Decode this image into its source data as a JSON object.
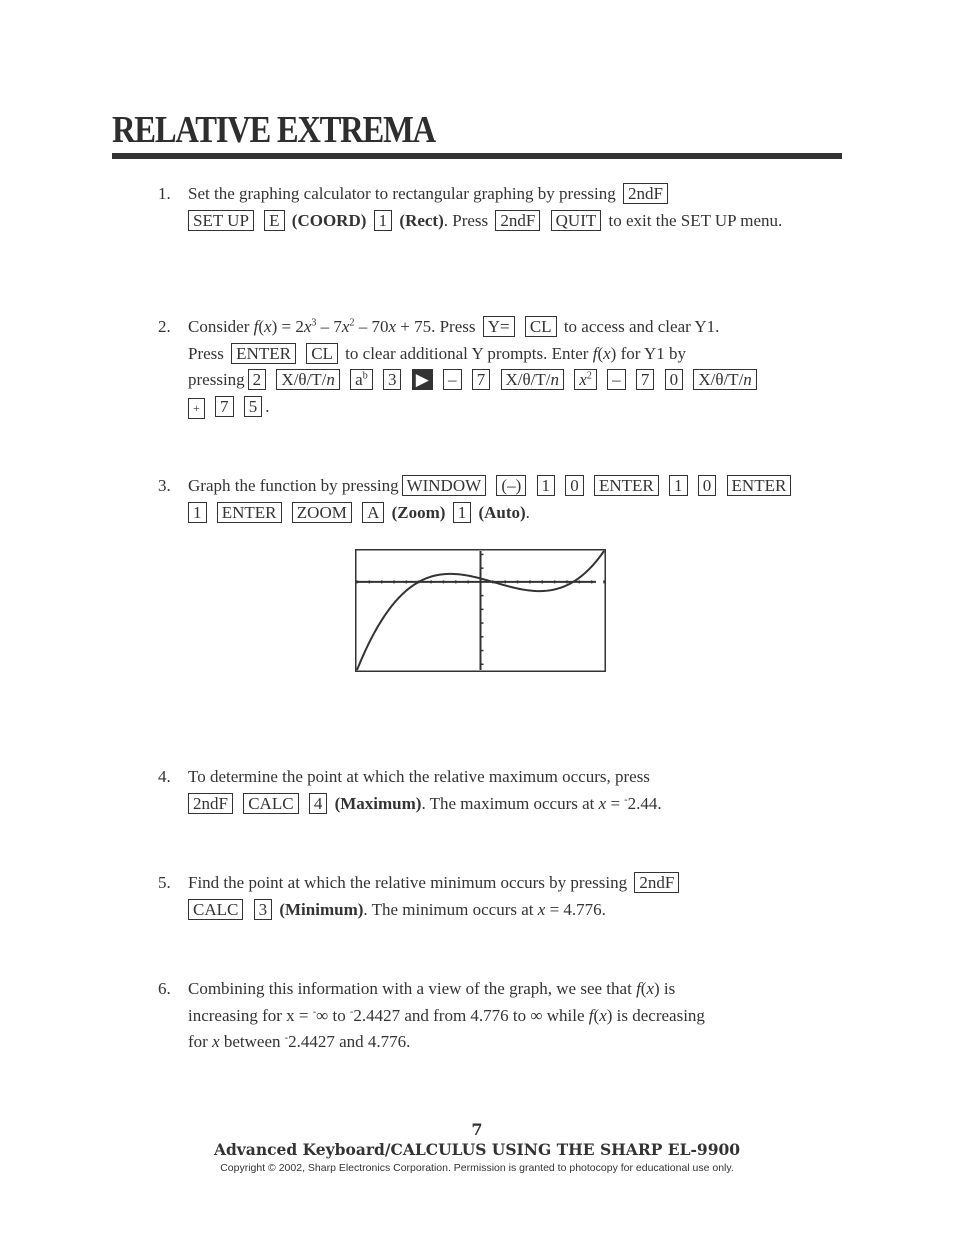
{
  "title": "RELATIVE EXTREMA",
  "steps": {
    "s1": {
      "num": "1.",
      "t1": "Set the graphing calculator to rectangular graphing by pressing",
      "k_2ndf": "2ndF",
      "k_setup": "SET UP",
      "k_e": "E",
      "coord": "(COORD)",
      "k_1": "1",
      "rect": "(Rect)",
      "t2": ".  Press",
      "k_2ndf2": "2ndF",
      "k_quit": "QUIT",
      "t3": "to exit the SET UP menu."
    },
    "s2": {
      "num": "2.",
      "t1": "Consider",
      "fx": "f",
      "x": "x",
      "eq_a": "(",
      "eq_b": ") = 2",
      "eq_c": "x",
      "exp3": "3",
      "eq_d": " – 7",
      "eq_e": "x",
      "exp2": "2",
      "eq_f": " – 70",
      "eq_g": "x",
      "eq_h": " + 75.  Press",
      "k_y": "Y=",
      "k_cl": "CL",
      "t2": "to access and clear Y1.",
      "t3": "Press",
      "k_enter": "ENTER",
      "k_cl2": "CL",
      "t4": "to clear additional Y prompts.  Enter",
      "t5": "for Y1 by",
      "t6": "pressing",
      "keys": [
        "2",
        "X/θ/T/",
        "a",
        "3",
        "▶",
        "–",
        "7",
        "X/θ/T/",
        "x",
        "–",
        "7",
        "0",
        "X/θ/T/",
        "+",
        "7",
        "5"
      ],
      "n": "n",
      "ab_sup": "b",
      "x2_sup": "2",
      "end": "."
    },
    "s3": {
      "num": "3.",
      "t1": "Graph the function by pressing",
      "keys": [
        "WINDOW",
        "(–)",
        "1",
        "0",
        "ENTER",
        "1",
        "0",
        "ENTER",
        "1",
        "ENTER",
        "ZOOM",
        "A"
      ],
      "zoom": "(Zoom)",
      "k_1": "1",
      "auto": "(Auto)",
      "end": "."
    },
    "s4": {
      "num": "4.",
      "t1": "To determine the point at which the relative maximum occurs, press",
      "k_2ndf": "2ndF",
      "k_calc": "CALC",
      "k_4": "4",
      "maximum": "(Maximum)",
      "t2": ".  The maximum occurs at",
      "x": "x",
      "t3": " = ",
      "value": "-2.44",
      "value_display": "2.44",
      "end": "."
    },
    "s5": {
      "num": "5.",
      "t1": "Find the point at which the relative minimum occurs by pressing",
      "k_2ndf": "2ndF",
      "k_calc": "CALC",
      "k_3": "3",
      "minimum": "(Minimum)",
      "t2": ".  The minimum occurs at",
      "x": "x",
      "t3": " = 4.776."
    },
    "s6": {
      "num": "6.",
      "t1": "Combining this information with a view of the graph, we see that",
      "fx": "f",
      "x": "x",
      "t2": "is increasing for x = ",
      "neg_inf": "∞",
      "t3": " to ",
      "v1": "2.4427",
      "t4": " and from 4.776 to ∞ while",
      "t5": "is decreasing for",
      "t6": "between",
      "v2": "2.4427",
      "t7": " and 4.776."
    }
  },
  "graph": {
    "function": "2x^3 - 7x^2 - 70x + 75",
    "xmin": -10,
    "xmax": 10,
    "xscl": 1,
    "ymin": -1925,
    "ymax": 675,
    "yscl": 300
  },
  "footer": {
    "page": "7",
    "title": "Advanced Keyboard/CALCULUS USING THE SHARP EL-9900",
    "copyright": "Copyright © 2002, Sharp Electronics Corporation.  Permission is granted to photocopy for educational use only."
  }
}
